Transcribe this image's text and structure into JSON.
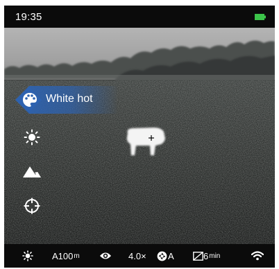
{
  "status_bar": {
    "time": "19:35",
    "battery_icon": "battery-full-icon",
    "battery_color": "#3cc44a"
  },
  "menu": {
    "items": [
      {
        "icon": "palette-icon",
        "label": "White hot",
        "selected": true
      },
      {
        "icon": "brightness-icon"
      },
      {
        "icon": "scene-mountain-icon"
      },
      {
        "icon": "reticle-icon"
      }
    ],
    "selected_color": "#2d62b0"
  },
  "bottom_bar": {
    "brightness_icon": "brightness-icon",
    "range_main": "A100",
    "range_unit": "m",
    "eye_icon": "eye-icon",
    "zoom": "4.0×",
    "calibration_icon": "shutter-icon",
    "calibration_mode": "A",
    "timer_icon": "sleep-timer-icon",
    "timer_value": "6",
    "timer_unit": "min",
    "wifi_icon": "wifi-icon"
  }
}
